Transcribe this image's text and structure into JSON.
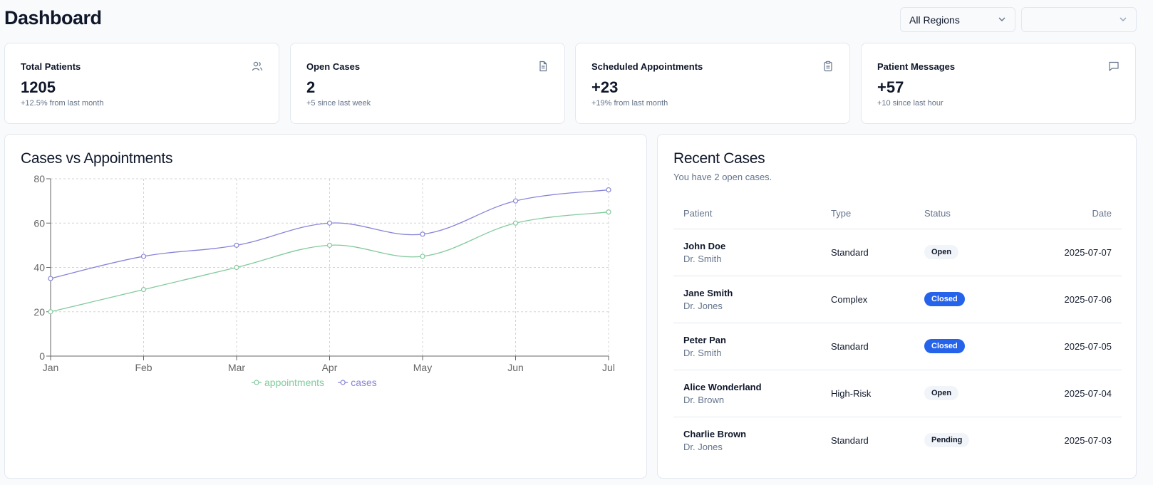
{
  "header": {
    "title": "Dashboard",
    "region_select": "All Regions",
    "second_select": ""
  },
  "stats": [
    {
      "label": "Total Patients",
      "value": "1205",
      "sub": "+12.5% from last month",
      "icon": "users-icon"
    },
    {
      "label": "Open Cases",
      "value": "2",
      "sub": "+5 since last week",
      "icon": "file-icon"
    },
    {
      "label": "Scheduled Appointments",
      "value": "+23",
      "sub": "+19% from last month",
      "icon": "clipboard-icon"
    },
    {
      "label": "Patient Messages",
      "value": "+57",
      "sub": "+10 since last hour",
      "icon": "message-icon"
    }
  ],
  "chart": {
    "title": "Cases vs Appointments"
  },
  "chart_data": {
    "type": "line",
    "categories": [
      "Jan",
      "Feb",
      "Mar",
      "Apr",
      "May",
      "Jun",
      "Jul"
    ],
    "series": [
      {
        "name": "appointments",
        "values": [
          20,
          30,
          40,
          50,
          45,
          60,
          65
        ],
        "color": "#82ca9d"
      },
      {
        "name": "cases",
        "values": [
          35,
          45,
          50,
          60,
          55,
          70,
          75
        ],
        "color": "#8884d8"
      }
    ],
    "yticks": [
      0,
      20,
      40,
      60,
      80
    ],
    "ylim": [
      0,
      80
    ],
    "grid": true,
    "legend": "bottom"
  },
  "recent": {
    "title": "Recent Cases",
    "subtitle": "You have 2 open cases.",
    "columns": [
      "Patient",
      "Type",
      "Status",
      "Date"
    ],
    "rows": [
      {
        "patient": "John Doe",
        "doctor": "Dr. Smith",
        "type": "Standard",
        "status": "Open",
        "date": "2025-07-07"
      },
      {
        "patient": "Jane Smith",
        "doctor": "Dr. Jones",
        "type": "Complex",
        "status": "Closed",
        "date": "2025-07-06"
      },
      {
        "patient": "Peter Pan",
        "doctor": "Dr. Smith",
        "type": "Standard",
        "status": "Closed",
        "date": "2025-07-05"
      },
      {
        "patient": "Alice Wonderland",
        "doctor": "Dr. Brown",
        "type": "High-Risk",
        "status": "Open",
        "date": "2025-07-04"
      },
      {
        "patient": "Charlie Brown",
        "doctor": "Dr. Jones",
        "type": "Standard",
        "status": "Pending",
        "date": "2025-07-03"
      }
    ]
  }
}
